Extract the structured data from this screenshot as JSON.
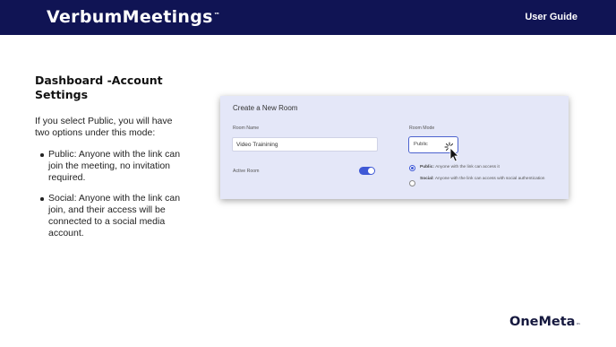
{
  "header": {
    "logo_text": "VerbumMeetings",
    "logo_mark": "™",
    "right_label": "User Guide",
    "background": "#101454"
  },
  "content": {
    "title": "Dashboard -Account Settings",
    "intro": "If you select Public, you will have two options under this mode:",
    "bullets": [
      "Public: Anyone with the link can join the meeting, no invitation required.",
      "Social: Anyone with the link can join, and their access will be connected to a social media account."
    ]
  },
  "card": {
    "title": "Create a New Room",
    "room_name_label": "Room Name",
    "room_name_value": "Video Trainining",
    "active_room_label": "Active Room",
    "active_room_on": true,
    "room_mode_label": "Room Mode",
    "room_mode_value": "Public",
    "options": [
      {
        "bold": "Public:",
        "text": "Anyone with the link can access it",
        "selected": true
      },
      {
        "bold": "Social:",
        "text": "Anyone with the link can access with social authentication",
        "selected": false
      }
    ],
    "accent": "#3f59d6"
  },
  "footer": {
    "brand": "OneMeta",
    "brand_mark": "™"
  }
}
